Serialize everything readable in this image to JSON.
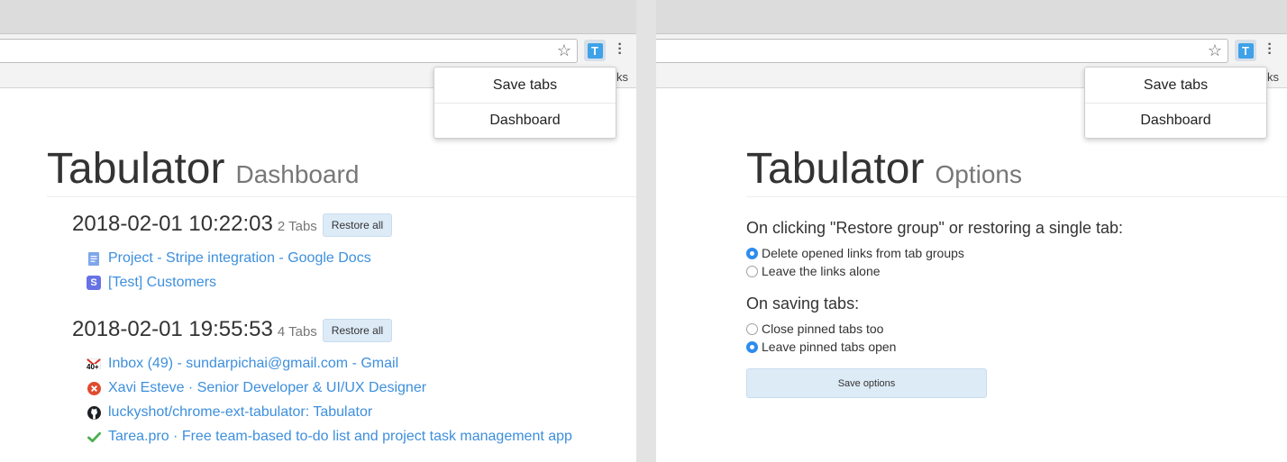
{
  "browser": {
    "bookmarks_fragment": "ks",
    "star_glyph": "☆",
    "menu_glyph": "⋮",
    "extension_letter": "T",
    "extension_color": "#3fa2e8"
  },
  "popup": {
    "save_tabs": "Save tabs",
    "dashboard": "Dashboard"
  },
  "dashboard": {
    "title": "Tabulator",
    "subtitle": "Dashboard",
    "link_color": "#3d8fdd",
    "groups": [
      {
        "date": "2018-02-01 10:22:03",
        "count": "2 Tabs",
        "restore_label": "Restore all",
        "tabs": [
          {
            "title": "Project - Stripe integration - Google Docs",
            "icon": "google-docs-icon"
          },
          {
            "title": "[Test] Customers",
            "icon": "stripe-icon",
            "icon_letter": "S"
          }
        ]
      },
      {
        "date": "2018-02-01 19:55:53",
        "count": "4 Tabs",
        "restore_label": "Restore all",
        "tabs": [
          {
            "title": "Inbox (49) - sundarpichai@gmail.com - Gmail",
            "icon": "gmail-icon",
            "icon_badge": "40+"
          },
          {
            "title": "Xavi Esteve · Senior Developer & UI/UX Designer",
            "icon": "x-circle-icon"
          },
          {
            "title": "luckyshot/chrome-ext-tabulator: Tabulator",
            "icon": "github-icon"
          },
          {
            "title": "Tarea.pro · Free team-based to-do list and project task management app",
            "icon": "checkmark-icon"
          }
        ]
      }
    ]
  },
  "options": {
    "title": "Tabulator",
    "subtitle": "Options",
    "restore_heading": "On clicking \"Restore group\" or restoring a single tab:",
    "restore_options": [
      {
        "label": "Delete opened links from tab groups",
        "selected": true
      },
      {
        "label": "Leave the links alone",
        "selected": false
      }
    ],
    "saving_heading": "On saving tabs:",
    "saving_options": [
      {
        "label": "Close pinned tabs too",
        "selected": false
      },
      {
        "label": "Leave pinned tabs open",
        "selected": true
      }
    ],
    "save_button": "Save options",
    "accent_color": "#2d8cf0"
  }
}
